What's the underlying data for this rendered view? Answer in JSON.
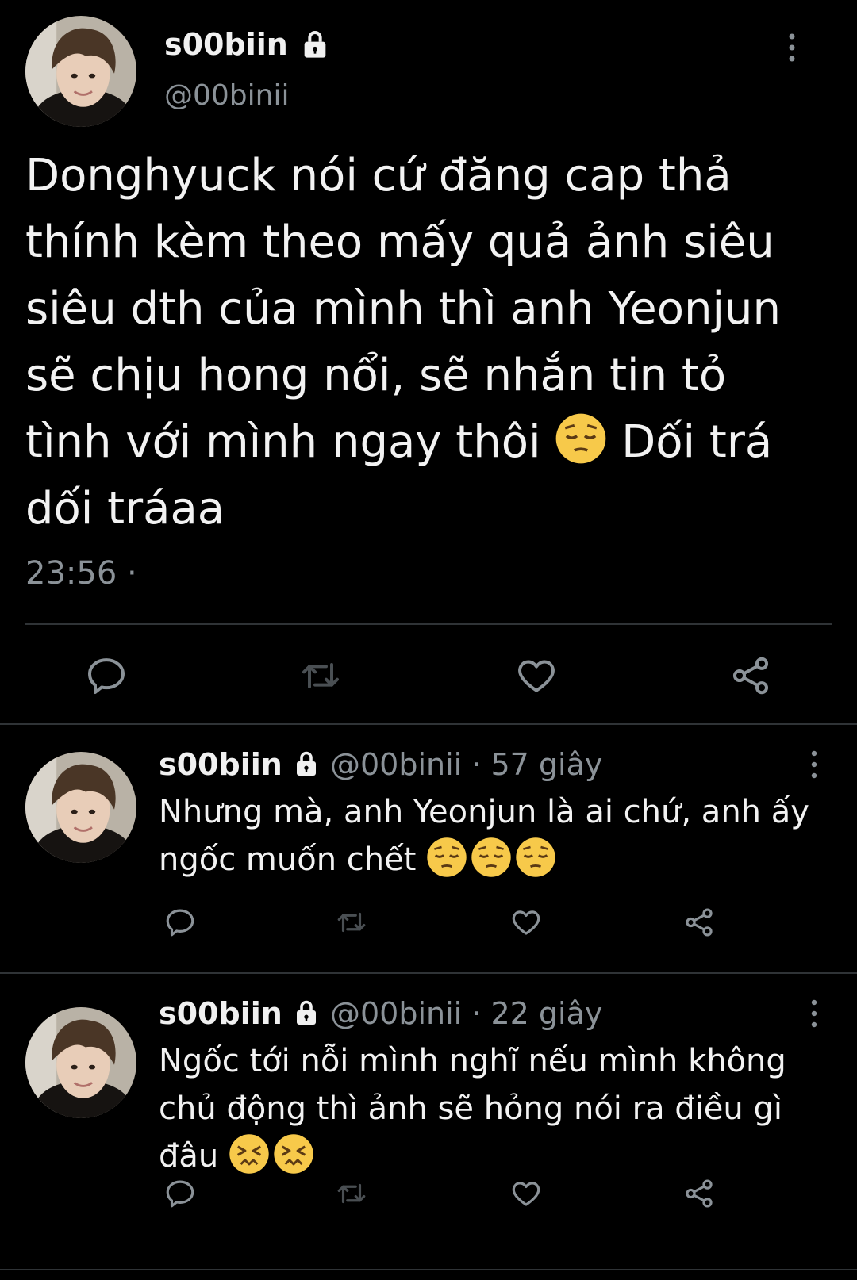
{
  "main_tweet": {
    "display_name": "s00biin",
    "handle": "@00binii",
    "text_before_emoji": "Donghyuck nói cứ đăng cap thả\nthính kèm theo mấy quả ảnh siêu\nsiêu dth của mình thì anh Yeonjun\nsẽ chịu hong nổi, sẽ nhắn tin tỏ\ntình với mình ngay thôi ",
    "emoji": "pensive-face",
    "text_after_emoji": " Dối trá\ndối tráaa",
    "time": "23:56 ·"
  },
  "replies": [
    {
      "display_name": "s00biin",
      "handle": "@00binii",
      "time": "· 57 giây",
      "text": "Nhưng mà, anh Yeonjun là ai chứ, anh ấy ngốc muốn chết ",
      "emojis": [
        "pensive-face",
        "pensive-face",
        "pensive-face"
      ]
    },
    {
      "display_name": "s00biin",
      "handle": "@00binii",
      "time": "· 22 giây",
      "text": "Ngốc tới nỗi mình nghĩ nếu mình không chủ động thì ảnh sẽ hỏng nói ra điều gì đâu ",
      "emojis": [
        "confounded-face",
        "confounded-face"
      ]
    }
  ],
  "icons": {
    "lock": "lock-icon",
    "more": "more-vertical-icon",
    "reply": "reply-icon",
    "retweet": "retweet-icon",
    "like": "heart-icon",
    "share": "share-icon"
  },
  "colors": {
    "background": "#000000",
    "text": "#f2f2f2",
    "muted": "#8b9298",
    "divider": "#2f3336",
    "emoji": "#f7c94a"
  }
}
